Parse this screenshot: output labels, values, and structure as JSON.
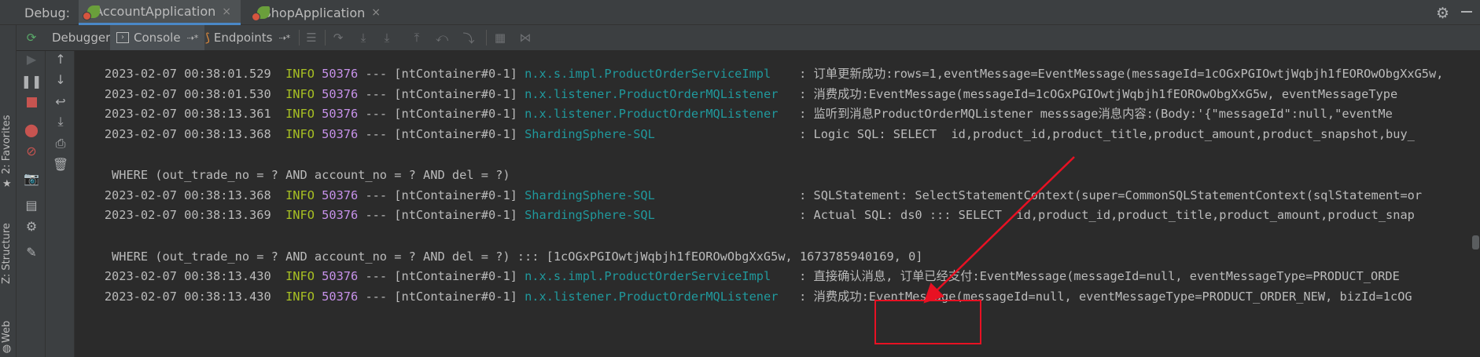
{
  "topbar": {
    "debug_label": "Debug:",
    "tabs": [
      {
        "label": "AccountApplication",
        "close": "×",
        "active": true
      },
      {
        "label": "ShopApplication",
        "close": "×",
        "active": false
      }
    ]
  },
  "toolbar": {
    "debugger_label": "Debugger",
    "console_label": "Console",
    "console_pin": "⇢*",
    "endpoints_label": "Endpoints",
    "endpoints_pin": "⇢*"
  },
  "side_strip": {
    "favorites": "2: Favorites",
    "structure": "Z: Structure",
    "web": "Web"
  },
  "console": {
    "lines": [
      {
        "ts": "2023-02-07 00:38:01.529",
        "lvl": "INFO",
        "pid": "50376",
        "sep": "---",
        "thread": "[ntContainer#0-1]",
        "logger": "n.x.s.impl.ProductOrderServiceImpl",
        "msg": ": 订单更新成功:rows=1,eventMessage=EventMessage(messageId=1cOGxPGIOwtjWqbjh1fEOROwObgXxG5w,"
      },
      {
        "ts": "2023-02-07 00:38:01.530",
        "lvl": "INFO",
        "pid": "50376",
        "sep": "---",
        "thread": "[ntContainer#0-1]",
        "logger": "n.x.listener.ProductOrderMQListener",
        "msg": ": 消费成功:EventMessage(messageId=1cOGxPGIOwtjWqbjh1fEOROwObgXxG5w, eventMessageType"
      },
      {
        "ts": "2023-02-07 00:38:13.361",
        "lvl": "INFO",
        "pid": "50376",
        "sep": "---",
        "thread": "[ntContainer#0-1]",
        "logger": "n.x.listener.ProductOrderMQListener",
        "msg": ": 监听到消息ProductOrderMQListener messsage消息内容:(Body:'{\"messageId\":null,\"eventMe"
      },
      {
        "ts": "2023-02-07 00:38:13.368",
        "lvl": "INFO",
        "pid": "50376",
        "sep": "---",
        "thread": "[ntContainer#0-1]",
        "logger": "ShardingSphere-SQL",
        "msg": ": Logic SQL: SELECT  id,product_id,product_title,product_amount,product_snapshot,buy_"
      },
      {
        "plain": " WHERE (out_trade_no = ? AND account_no = ? AND del = ?)"
      },
      {
        "ts": "2023-02-07 00:38:13.368",
        "lvl": "INFO",
        "pid": "50376",
        "sep": "---",
        "thread": "[ntContainer#0-1]",
        "logger": "ShardingSphere-SQL",
        "msg": ": SQLStatement: SelectStatementContext(super=CommonSQLStatementContext(sqlStatement=or"
      },
      {
        "ts": "2023-02-07 00:38:13.369",
        "lvl": "INFO",
        "pid": "50376",
        "sep": "---",
        "thread": "[ntContainer#0-1]",
        "logger": "ShardingSphere-SQL",
        "msg": ": Actual SQL: ds0 ::: SELECT  id,product_id,product_title,product_amount,product_snap"
      },
      {
        "plain": " WHERE (out_trade_no = ? AND account_no = ? AND del = ?) ::: [1cOGxPGIOwtjWqbjh1fEOROwObgXxG5w, 1673785940169, 0]"
      },
      {
        "ts": "2023-02-07 00:38:13.430",
        "lvl": "INFO",
        "pid": "50376",
        "sep": "---",
        "thread": "[ntContainer#0-1]",
        "logger": "n.x.s.impl.ProductOrderServiceImpl",
        "msg": ": 直接确认消息, 订单已经支付:EventMessage(messageId=null, eventMessageType=PRODUCT_ORDE"
      },
      {
        "ts": "2023-02-07 00:38:13.430",
        "lvl": "INFO",
        "pid": "50376",
        "sep": "---",
        "thread": "[ntContainer#0-1]",
        "logger": "n.x.listener.ProductOrderMQListener",
        "msg": ": 消费成功:EventMessage(messageId=null, eventMessageType=PRODUCT_ORDER_NEW, bizId=1cOG"
      }
    ]
  },
  "colors": {
    "accent": "#4a88c7",
    "annotation": "#e81123",
    "info": "#a8c023",
    "logger": "#20999d",
    "pid": "#c792ea"
  }
}
